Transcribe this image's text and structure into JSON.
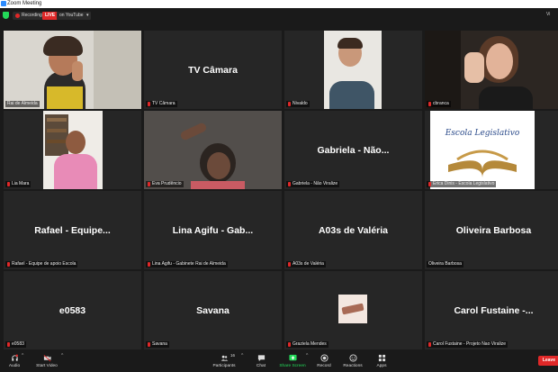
{
  "window": {
    "title": "Zoom Meeting"
  },
  "status": {
    "recording_label": "Recording",
    "live_label": "LIVE",
    "stream_label": "on YouTube",
    "view_label": "Vi"
  },
  "tiles": [
    {
      "name": "Rai de Almeida",
      "big": "",
      "video": true,
      "muted": false,
      "active": true
    },
    {
      "name": "TV Câmara",
      "big": "TV Câmara",
      "video": false,
      "muted": true
    },
    {
      "name": "Nivaldo",
      "big": "",
      "video": true,
      "muted": true
    },
    {
      "name": "cbranca",
      "big": "",
      "video": true,
      "muted": true
    },
    {
      "name": "Lia Mara",
      "big": "",
      "video": true,
      "muted": true
    },
    {
      "name": "Eva Prudêncio",
      "big": "",
      "video": true,
      "muted": true
    },
    {
      "name": "Gabriela - Não Viralize",
      "big": "Gabriela - Não...",
      "video": false,
      "muted": true
    },
    {
      "name": "Érica Dinis - Escola Legislativo",
      "big": "",
      "video": true,
      "muted": true,
      "logo": "Escola Legislativo"
    },
    {
      "name": "Rafael - Equipe de apoio Escola",
      "big": "Rafael - Equipe...",
      "video": false,
      "muted": true
    },
    {
      "name": "Lina Agifu - Gabinete Rai de Almeida",
      "big": "Lina Agifu - Gab...",
      "video": false,
      "muted": true
    },
    {
      "name": "A03s de Valéria",
      "big": "A03s de Valéria",
      "video": false,
      "muted": true
    },
    {
      "name": "Oliveira Barbosa",
      "big": "Oliveira Barbosa",
      "video": false,
      "muted": false
    },
    {
      "name": "e0583",
      "big": "e0583",
      "video": false,
      "muted": true
    },
    {
      "name": "Savana",
      "big": "Savana",
      "video": false,
      "muted": true
    },
    {
      "name": "Graziela Mendes",
      "big": "",
      "video": false,
      "muted": true,
      "thumb": true
    },
    {
      "name": "Carol Fustaine - Projeto Nao Viralize",
      "big": "Carol Fustaine -...",
      "video": false,
      "muted": true
    }
  ],
  "toolbar": {
    "audio": "Audio",
    "start_video": "Start Video",
    "participants": "Participants",
    "participants_count": "16",
    "chat": "Chat",
    "share_screen": "Share Screen",
    "record": "Record",
    "reactions": "Reactions",
    "apps": "Apps",
    "leave": "Leave"
  },
  "colors": {
    "active_border": "#c8e23c",
    "live": "#e02828",
    "share": "#23d959"
  }
}
